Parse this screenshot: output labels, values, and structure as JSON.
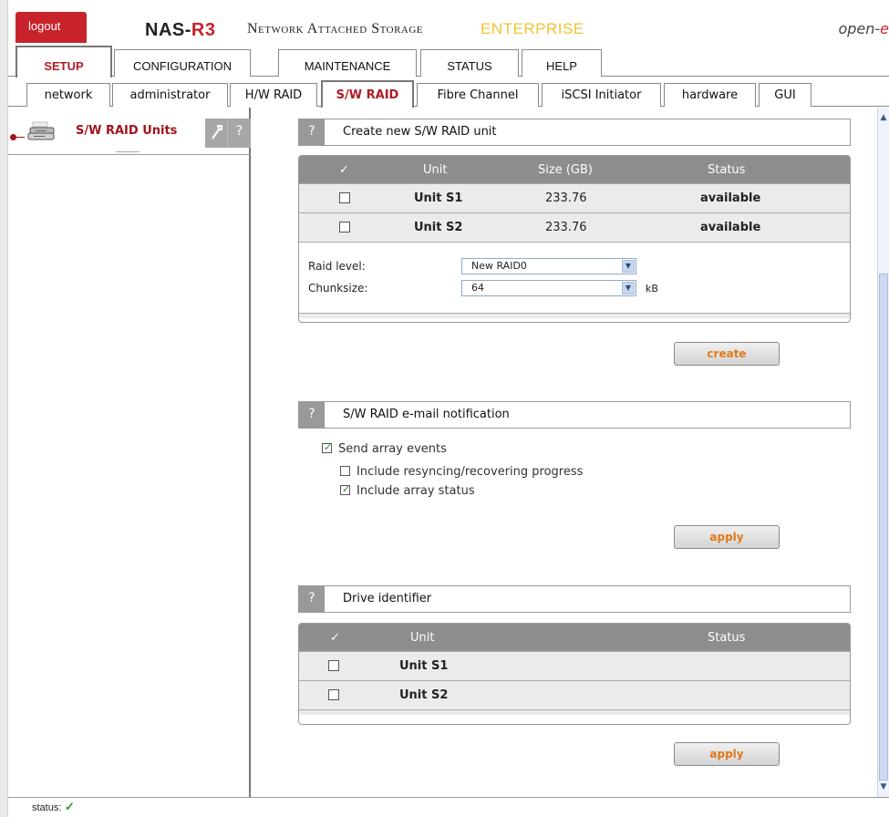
{
  "header": {
    "logout_label": "logout",
    "brand_prefix": "NAS-",
    "brand_suffix": "R3",
    "subtitle": "Network Attached Storage",
    "edition": "ENTERPRISE",
    "vendor_prefix": "open-",
    "vendor_suffix": "e"
  },
  "main_tabs": [
    {
      "label": "SETUP",
      "active": true
    },
    {
      "label": "CONFIGURATION"
    },
    {
      "label": "MAINTENANCE"
    },
    {
      "label": "STATUS"
    },
    {
      "label": "HELP"
    }
  ],
  "sub_tabs": [
    {
      "label": "network"
    },
    {
      "label": "administrator"
    },
    {
      "label": "H/W RAID"
    },
    {
      "label": "S/W RAID",
      "active": true
    },
    {
      "label": "Fibre Channel"
    },
    {
      "label": "iSCSI Initiator"
    },
    {
      "label": "hardware"
    },
    {
      "label": "GUI"
    }
  ],
  "sidebar": {
    "title": "S/W RAID Units",
    "tool_icon": "wrench-icon",
    "help_glyph": "?"
  },
  "create_section": {
    "help_glyph": "?",
    "title": "Create new S/W RAID unit",
    "columns": {
      "check": "✓",
      "unit": "Unit",
      "size": "Size (GB)",
      "status": "Status"
    },
    "rows": [
      {
        "unit": "Unit S1",
        "size": "233.76",
        "status": "available",
        "checked": false
      },
      {
        "unit": "Unit S2",
        "size": "233.76",
        "status": "available",
        "checked": false
      }
    ],
    "raid_level_label": "Raid level:",
    "raid_level_value": "New RAID0",
    "chunksize_label": "Chunksize:",
    "chunksize_value": "64",
    "chunksize_unit": "kB",
    "button_label": "create"
  },
  "email_section": {
    "help_glyph": "?",
    "title": "S/W RAID e-mail notification",
    "send_events_label": "Send array events",
    "send_events_checked": true,
    "resync_label": "Include resyncing/recovering progress",
    "resync_checked": false,
    "array_status_label": "Include array status",
    "array_status_checked": true,
    "button_label": "apply"
  },
  "drive_section": {
    "help_glyph": "?",
    "title": "Drive identifier",
    "columns": {
      "check": "✓",
      "unit": "Unit",
      "status": "Status"
    },
    "rows": [
      {
        "unit": "Unit S1",
        "checked": false
      },
      {
        "unit": "Unit S2",
        "checked": false
      }
    ],
    "button_label": "apply"
  },
  "statusbar": {
    "label": "status:",
    "ok_glyph": "✓"
  },
  "colors": {
    "brand_red": "#c8232c",
    "edition_yellow": "#f2c230",
    "button_text_orange": "#e07a1a",
    "table_header_gray": "#8d8d8d"
  }
}
